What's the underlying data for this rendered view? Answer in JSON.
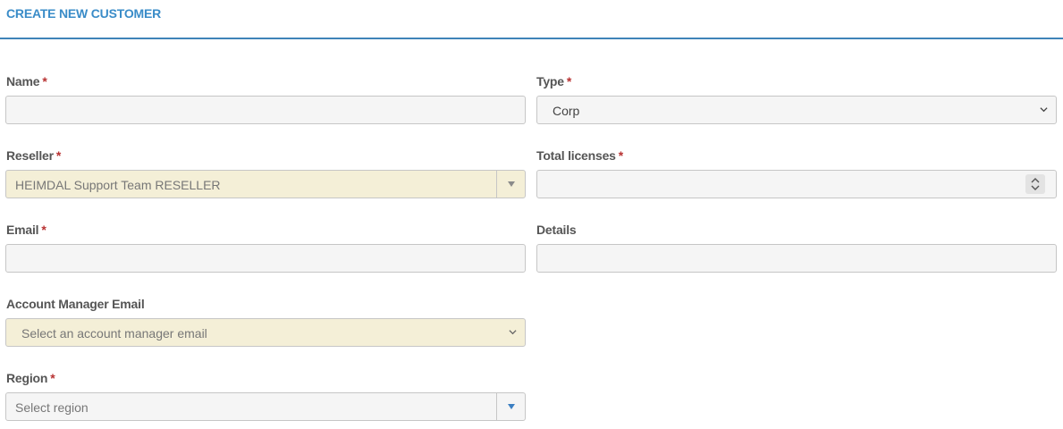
{
  "page": {
    "title": "CREATE NEW CUSTOMER"
  },
  "required_marker": "*",
  "form": {
    "name": {
      "label": "Name",
      "value": ""
    },
    "type": {
      "label": "Type",
      "value": "Corp"
    },
    "reseller": {
      "label": "Reseller",
      "value": "HEIMDAL Support Team RESELLER"
    },
    "total_licenses": {
      "label": "Total licenses",
      "value": ""
    },
    "email": {
      "label": "Email",
      "value": ""
    },
    "details": {
      "label": "Details",
      "value": ""
    },
    "account_manager_email": {
      "label": "Account Manager Email",
      "placeholder": "Select an account manager email"
    },
    "region": {
      "label": "Region",
      "placeholder": "Select region"
    }
  },
  "icons": {
    "type_dropdown": "chevron-down-icon",
    "reseller_dropdown": "caret-down-icon",
    "licenses_spinner": "spinner-updown-icon",
    "account_manager_dropdown": "chevron-down-icon",
    "region_dropdown": "caret-down-icon"
  },
  "colors": {
    "title": "#3a8cc8",
    "rule": "#3f84b8",
    "required": "#b83232",
    "field_bg": "#f5f5f5",
    "readonly_bg": "#f4efd7",
    "region_caret": "#3b7fc2"
  }
}
